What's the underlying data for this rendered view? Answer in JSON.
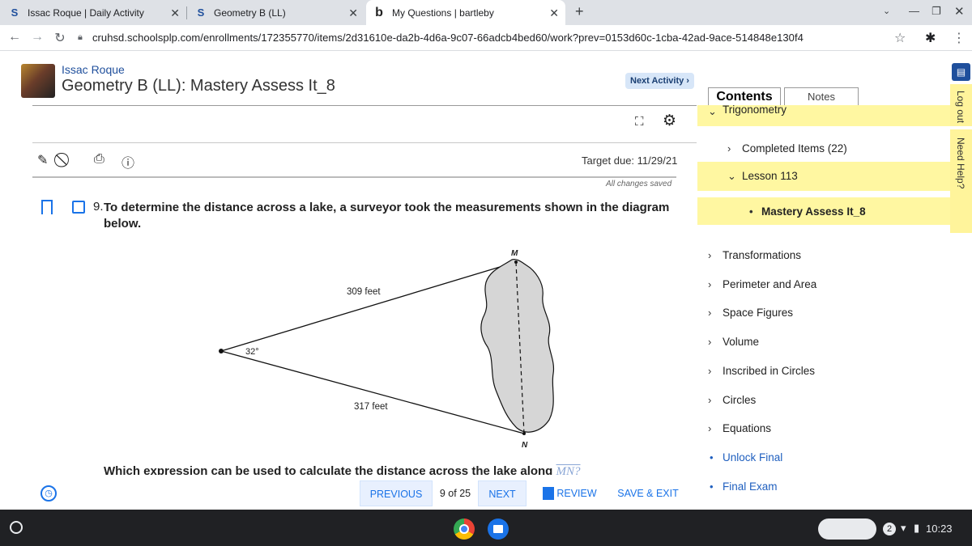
{
  "browser": {
    "tabs": [
      {
        "label": "Issac Roque | Daily Activity",
        "icon": "s-icon"
      },
      {
        "label": "Geometry B (LL)",
        "icon": "s-icon"
      },
      {
        "label": "My Questions | bartleby",
        "icon": "b-icon"
      }
    ],
    "url": "cruhsd.schoolsplp.com/enrollments/172355770/items/2d31610e-da2b-4d6a-9c07-66adcb4bed60/work?prev=0153d60c-1cba-42ad-9ace-514848e130f4"
  },
  "header": {
    "student_name": "Issac Roque",
    "course_title": "Geometry B (LL): Mastery Assess It_8",
    "next_activity": "Next Activity ›"
  },
  "toolbar": {
    "target_due": "Target due: 11/29/21",
    "save_status": "All changes saved"
  },
  "question": {
    "number": "9.",
    "text": "To determine the distance across a lake, a surveyor took the measurements shown in the diagram below.",
    "followup": "Which expression can be used to calculate the distance across the lake along",
    "followup_math": "MN?"
  },
  "diagram": {
    "label_top": "309 feet",
    "label_bottom": "317 feet",
    "angle": "32°",
    "point_m": "M",
    "point_n": "N"
  },
  "nav": {
    "previous": "PREVIOUS",
    "position": "9 of 25",
    "next": "NEXT",
    "review": "REVIEW",
    "save_exit": "SAVE & EXIT"
  },
  "sidebar": {
    "tab_contents": "Contents",
    "tab_notes": "Notes",
    "items": [
      {
        "label": "Trigonometry",
        "chevron": "v"
      },
      {
        "label": "Completed Items (22)",
        "chevron": ">"
      },
      {
        "label": "Lesson 113",
        "chevron": "v"
      },
      {
        "label": "Mastery Assess It_8",
        "chevron": "•"
      },
      {
        "label": "Transformations",
        "chevron": ">"
      },
      {
        "label": "Perimeter and Area",
        "chevron": ">"
      },
      {
        "label": "Space Figures",
        "chevron": ">"
      },
      {
        "label": "Volume",
        "chevron": ">"
      },
      {
        "label": "Inscribed in Circles",
        "chevron": ">"
      },
      {
        "label": "Circles",
        "chevron": ">"
      },
      {
        "label": "Equations",
        "chevron": ">"
      },
      {
        "label": "Unlock Final",
        "chevron": "•"
      },
      {
        "label": "Final Exam",
        "chevron": "•"
      }
    ],
    "log_out": "Log out",
    "need_help": "Need Help?"
  },
  "shelf": {
    "notification_count": "2",
    "time": "10:23"
  },
  "colors": {
    "accent_blue": "#1a73e8",
    "highlight_yellow": "#fff7a1",
    "shelf": "#202124"
  }
}
